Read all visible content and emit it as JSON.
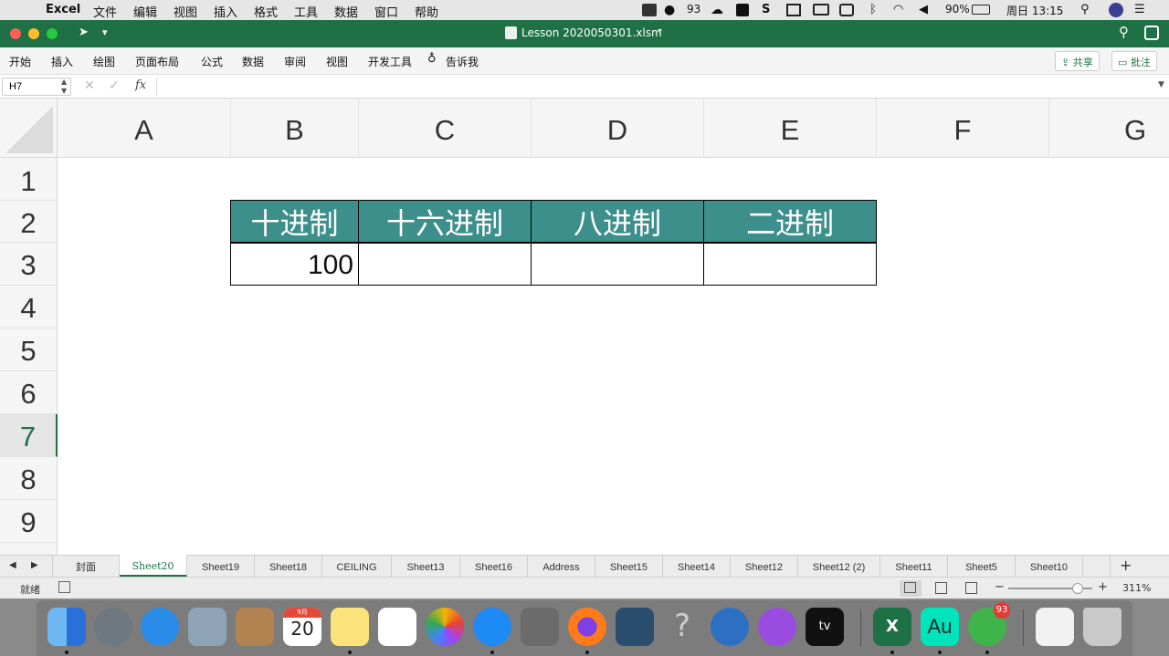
{
  "menubar": {
    "app": "Excel",
    "items": [
      "文件",
      "编辑",
      "视图",
      "插入",
      "格式",
      "工具",
      "数据",
      "窗口",
      "帮助"
    ],
    "wechat_count": "93",
    "battery": "90%",
    "clock": "周日 13:15"
  },
  "window": {
    "title": "Lesson 2020050301.xlsm"
  },
  "ribbon": {
    "tabs": [
      "开始",
      "插入",
      "绘图",
      "页面布局",
      "公式",
      "数据",
      "审阅",
      "视图",
      "开发工具"
    ],
    "tell_me": "告诉我",
    "share_label": "共享",
    "comments_label": "批注"
  },
  "formula_bar": {
    "name_box": "H7",
    "fx": "fx",
    "value": ""
  },
  "grid": {
    "columns": [
      "A",
      "B",
      "C",
      "D",
      "E",
      "F",
      "G"
    ],
    "rows": [
      "1",
      "2",
      "3",
      "4",
      "5",
      "6",
      "7",
      "8",
      "9"
    ],
    "selected_row": "7",
    "table": {
      "headers": [
        "十进制",
        "十六进制",
        "八进制",
        "二进制"
      ],
      "values": [
        "100",
        "",
        "",
        ""
      ]
    },
    "header_color": "#3d8f8c"
  },
  "sheets": {
    "tabs": [
      "封面",
      "Sheet20",
      "Sheet19",
      "Sheet18",
      "CEILING",
      "Sheet13",
      "Sheet16",
      "Address",
      "Sheet15",
      "Sheet14",
      "Sheet12",
      "Sheet12 (2)",
      "Sheet11",
      "Sheet5",
      "Sheet10"
    ],
    "active": "Sheet20"
  },
  "status": {
    "ready": "就绪",
    "zoom": "311%"
  },
  "dock": {
    "calendar_month": "9月",
    "calendar_day": "20",
    "wechat_badge": "93",
    "excel_letter": "X",
    "audition_label": "Au",
    "appletv_label": "tv"
  }
}
